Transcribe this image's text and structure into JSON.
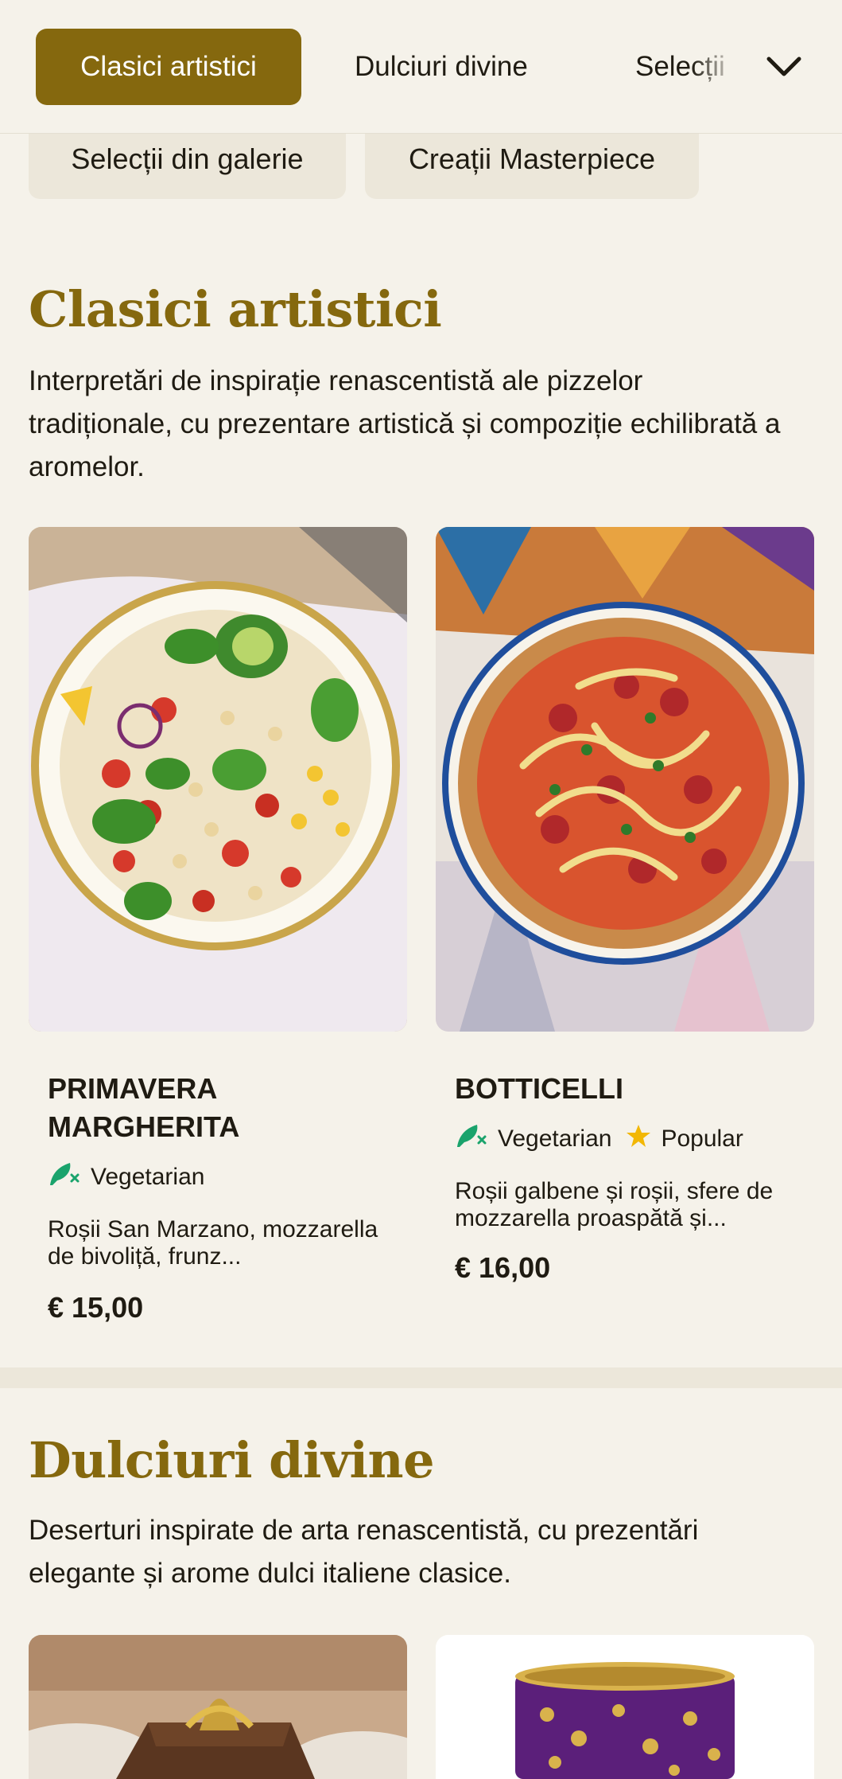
{
  "category_nav": {
    "active": "Clasici artistici",
    "tab2": "Dulciuri divine",
    "tab3": "Selecții",
    "chips": [
      "Selecții din galerie",
      "Creații Masterpiece"
    ]
  },
  "sections": [
    {
      "title": "Clasici artistici",
      "description": "Interpretări de inspirație renascentistă ale pizzelor tradiționale, cu prezentare artistică și compoziție echilibrată a aromelor.",
      "items": [
        {
          "name": "Primavera Margherita",
          "tags": [
            "Vegetarian"
          ],
          "description": "Roșii San Marzano, mozzarella de bivoliță, frunz...",
          "price": "€ 15,00"
        },
        {
          "name": "Botticelli",
          "tags": [
            "Vegetarian",
            "Popular"
          ],
          "description": "Roșii galbene și roșii, sfere de mozzarella proaspătă și...",
          "price": "€ 16,00"
        }
      ]
    },
    {
      "title": "Dulciuri divine",
      "description": "Deserturi inspirate de arta renascentistă, cu prezentări elegante și arome dulci italiene clasice."
    }
  ],
  "colors": {
    "accent": "#85680e",
    "background": "#f5f2ea",
    "chip": "#ece7da",
    "vegetarian_icon": "#1aa36c",
    "popular_star": "#f2b705"
  },
  "icons": {
    "dropdown": "chevron-down-icon",
    "vegetarian": "vegetarian-leaf-icon",
    "popular": "star-icon"
  }
}
